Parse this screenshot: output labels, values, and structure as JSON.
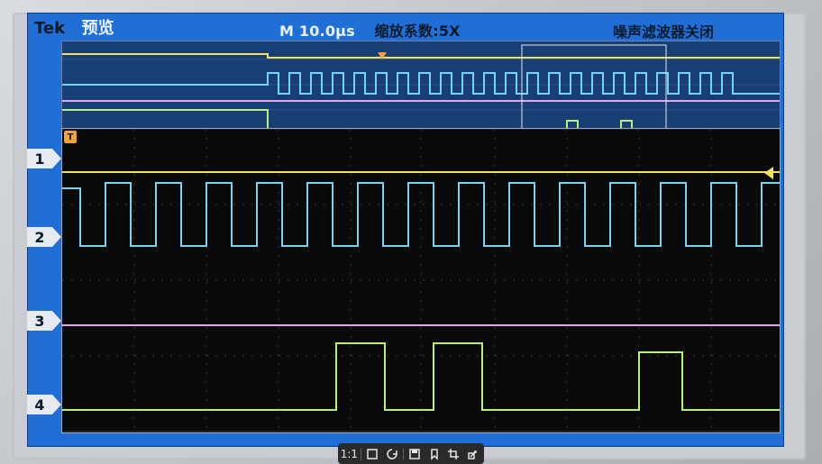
{
  "header": {
    "brand": "Tek",
    "mode": "预览",
    "timebase": "M 10.0μs",
    "zoom": "缩放系数:5X",
    "noise_filter": "噪声滤波器关闭"
  },
  "channels": [
    {
      "id": "1",
      "color": "#f3e25b"
    },
    {
      "id": "2",
      "color": "#74d4f1"
    },
    {
      "id": "3",
      "color": "#e6a7f0"
    },
    {
      "id": "4",
      "color": "#b6f27a"
    }
  ],
  "toolbar": {
    "items": [
      {
        "label": "1:1",
        "icon": "actual-size-icon"
      },
      {
        "label": "",
        "icon": "fit-icon"
      },
      {
        "label": "",
        "icon": "rotate-icon"
      },
      {
        "label": "",
        "icon": "save-icon"
      },
      {
        "label": "",
        "icon": "bookmark-icon"
      },
      {
        "label": "",
        "icon": "crop-icon"
      },
      {
        "label": "",
        "icon": "share-icon"
      }
    ]
  },
  "markers": {
    "trigger": "T"
  }
}
